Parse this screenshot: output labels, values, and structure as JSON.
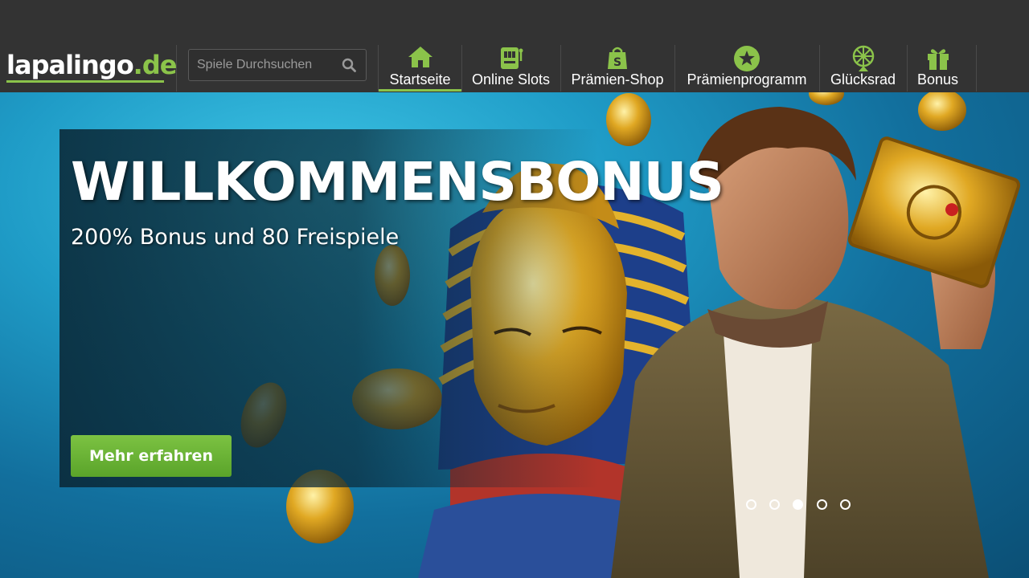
{
  "header": {
    "logo_main": "lapalingo",
    "logo_tld": ".de",
    "search": {
      "placeholder": "Spiele Durchsuchen",
      "icon": "search-icon"
    },
    "nav": [
      {
        "label": "Startseite",
        "icon": "home-icon",
        "active": true
      },
      {
        "label": "Online Slots",
        "icon": "slot-machine-icon",
        "active": false
      },
      {
        "label": "Prämien-Shop",
        "icon": "shopping-bag-icon",
        "active": false
      },
      {
        "label": "Prämienprogramm",
        "icon": "star-icon",
        "active": false
      },
      {
        "label": "Glücksrad",
        "icon": "wheel-icon",
        "active": false
      },
      {
        "label": "Bonus",
        "icon": "gift-icon",
        "active": false
      }
    ]
  },
  "hero": {
    "title": "WILLKOMMENSBONUS",
    "subtitle": "200% Bonus und 80 Freispiele",
    "cta_label": "Mehr erfahren",
    "slides_count": 5,
    "active_slide": 3
  },
  "colors": {
    "accent": "#8bc34a",
    "header_bg": "#333333",
    "cta": "#6ab536"
  }
}
